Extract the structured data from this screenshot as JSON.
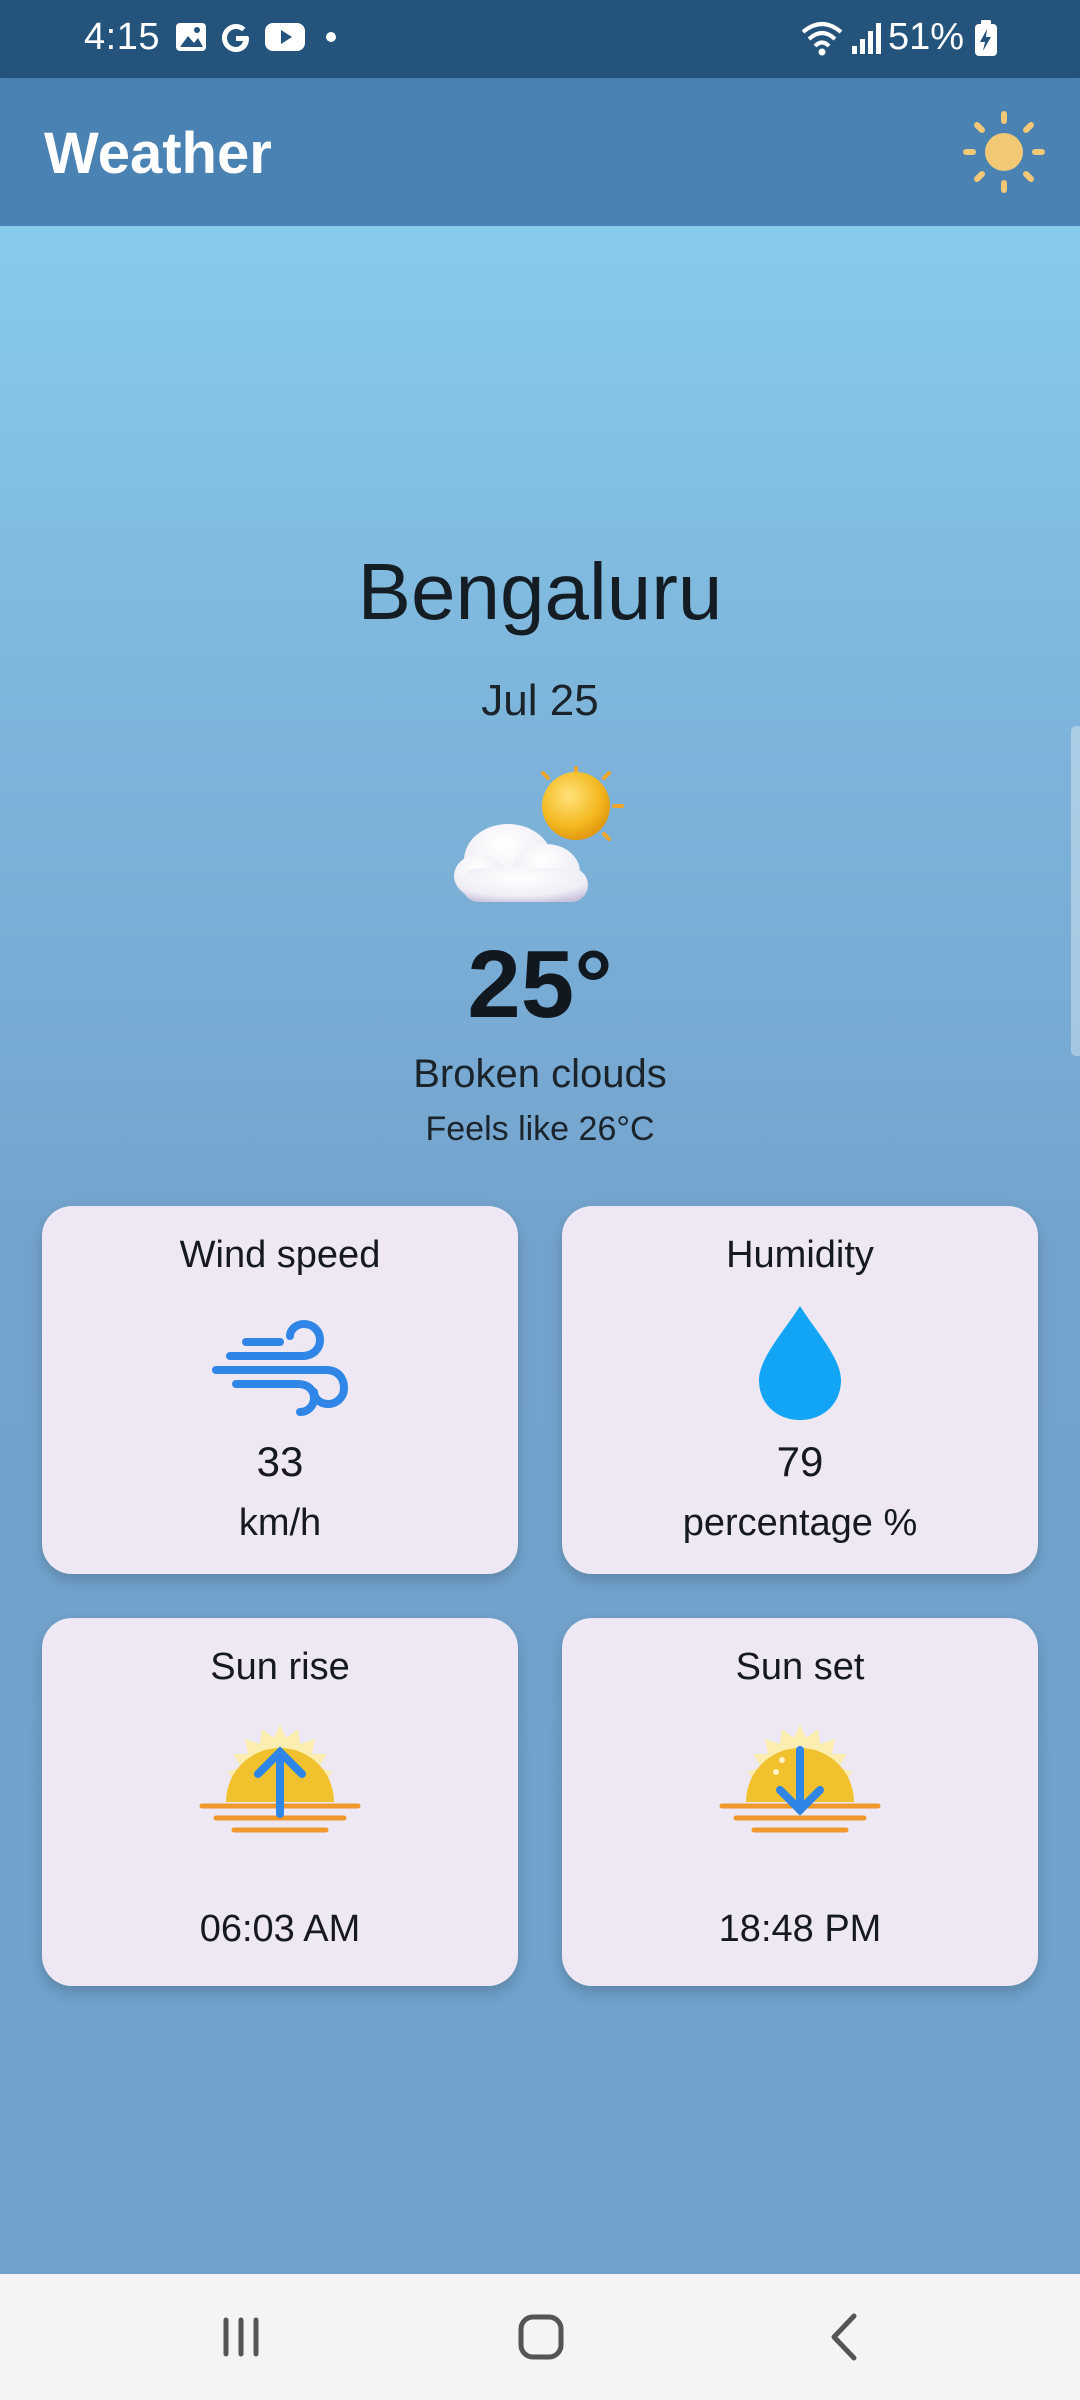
{
  "status_bar": {
    "time": "4:15",
    "battery": "51%",
    "icons": [
      "gallery-icon",
      "google-icon",
      "youtube-icon",
      "dot-icon",
      "wifi-icon",
      "signal-icon",
      "battery-charging-icon"
    ]
  },
  "app_bar": {
    "title": "Weather",
    "theme_icon": "sun-icon"
  },
  "weather": {
    "city": "Bengaluru",
    "date": "Jul 25",
    "icon": "partly-cloudy-icon",
    "temperature": "25°",
    "description": "Broken clouds",
    "feels_like": "Feels like 26°C"
  },
  "cards": {
    "wind": {
      "title": "Wind speed",
      "value": "33",
      "unit": "km/h",
      "icon": "wind-icon"
    },
    "humidity": {
      "title": "Humidity",
      "value": "79",
      "unit": "percentage %",
      "icon": "water-drop-icon"
    },
    "sunrise": {
      "title": "Sun rise",
      "time": "06:03 AM",
      "icon": "sunrise-icon"
    },
    "sunset": {
      "title": "Sun set",
      "time": "18:48 PM",
      "icon": "sunset-icon"
    }
  },
  "nav_bar": {
    "buttons": [
      "recents-icon",
      "home-icon",
      "back-icon"
    ]
  },
  "colors": {
    "status_bar": "#24537c",
    "app_bar": "#4a82b4",
    "card": "#ede8f3",
    "humidity_drop": "#12a5f5",
    "wind": "#2f86e6",
    "sun": "#f2c12e"
  }
}
